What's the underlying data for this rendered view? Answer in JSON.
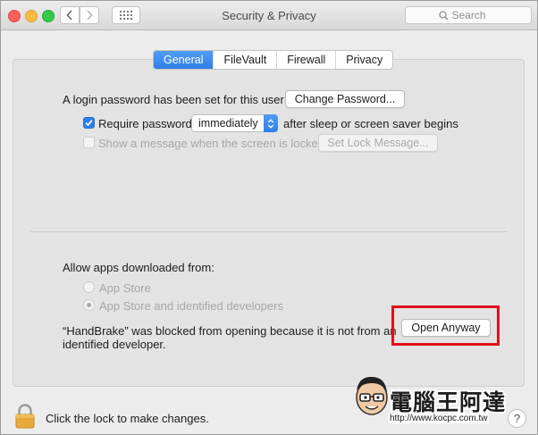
{
  "window": {
    "title": "Security & Privacy"
  },
  "search": {
    "placeholder": "Search"
  },
  "tabs": [
    {
      "label": "General",
      "active": true
    },
    {
      "label": "FileVault",
      "active": false
    },
    {
      "label": "Firewall",
      "active": false
    },
    {
      "label": "Privacy",
      "active": false
    }
  ],
  "general": {
    "login_text": "A login password has been set for this user",
    "change_password_label": "Change Password...",
    "require_password_label": "Require password",
    "require_password_checked": true,
    "require_password_delay": "immediately",
    "after_sleep_text": "after sleep or screen saver begins",
    "show_message_label": "Show a message when the screen is locked",
    "show_message_checked": false,
    "set_lock_message_label": "Set Lock Message..."
  },
  "allow_apps": {
    "heading": "Allow apps downloaded from:",
    "options": [
      {
        "label": "App Store",
        "selected": false
      },
      {
        "label": "App Store and identified developers",
        "selected": true
      }
    ],
    "blocked_line1": "“HandBrake” was blocked from opening because it is not from an",
    "blocked_line2": "identified developer.",
    "open_anyway_label": "Open Anyway"
  },
  "footer": {
    "lock_text": "Click the lock to make changes.",
    "help_label": "?"
  },
  "watermark": {
    "chinese": "電腦王阿達",
    "url": "http://www.kocpc.com.tw"
  },
  "colors": {
    "accent": "#2f7fe8",
    "highlight": "#e0101b"
  }
}
